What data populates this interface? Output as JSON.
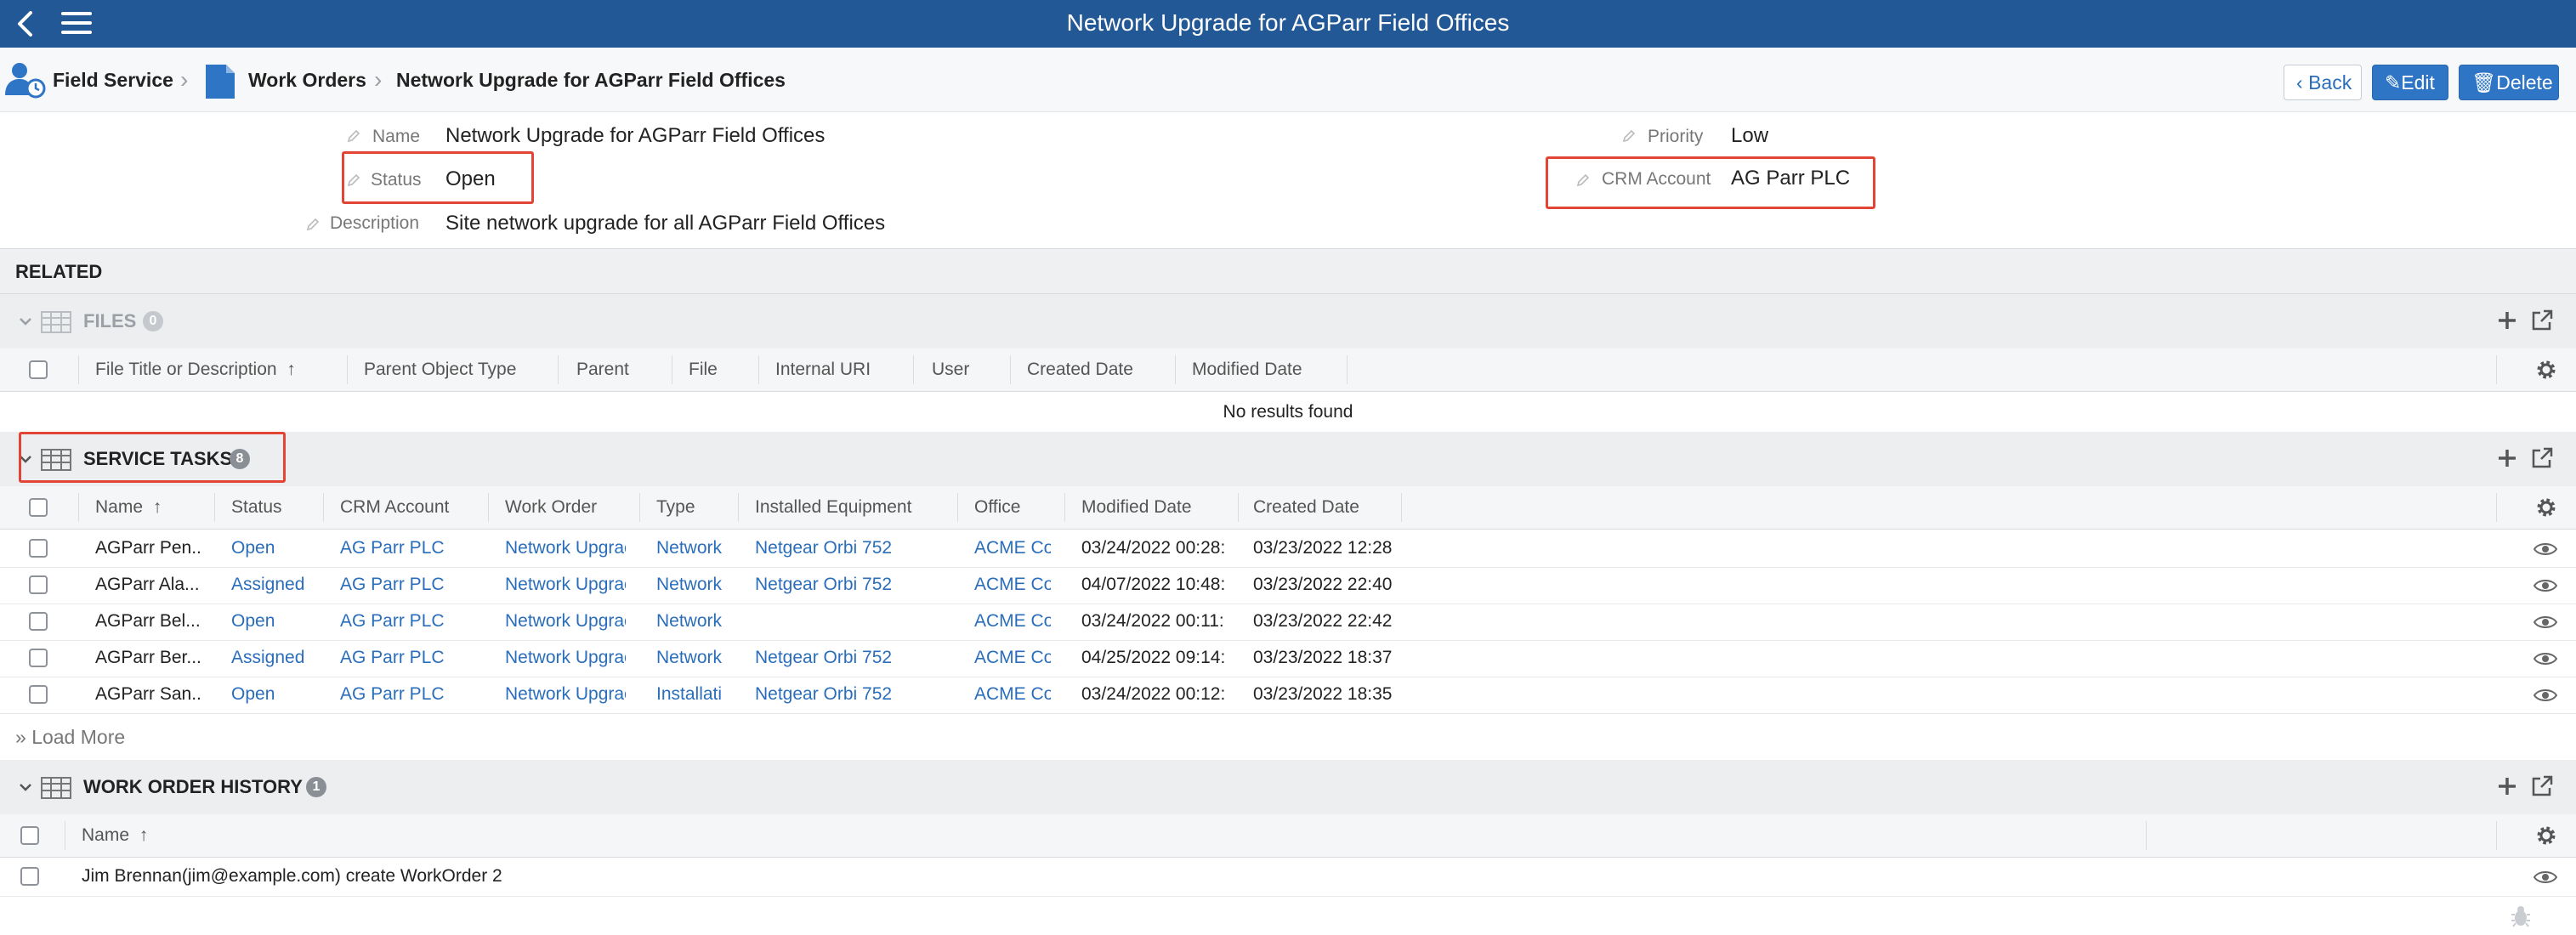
{
  "window": {
    "title": "Network Upgrade for AGParr Field Offices"
  },
  "breadcrumb": {
    "app": "Field Service",
    "section": "Work Orders",
    "record": "Network Upgrade for AGParr Field Offices"
  },
  "actions": {
    "back": "Back",
    "edit": "Edit",
    "delete": "Delete"
  },
  "fields": {
    "name": {
      "label": "Name",
      "value": "Network Upgrade for AGParr Field Offices"
    },
    "status": {
      "label": "Status",
      "value": "Open"
    },
    "description": {
      "label": "Description",
      "value": "Site network upgrade for all AGParr Field Offices"
    },
    "priority": {
      "label": "Priority",
      "value": "Low"
    },
    "crm_account": {
      "label": "CRM Account",
      "value": "AG Parr PLC"
    }
  },
  "related": {
    "heading": "RELATED",
    "files": {
      "title": "FILES",
      "count": "0",
      "columns": [
        "File Title or Description",
        "Parent Object Type",
        "Parent",
        "File",
        "Internal URI",
        "User",
        "Created Date",
        "Modified Date"
      ],
      "sort_indicator": "↑",
      "empty_text": "No results found"
    },
    "service_tasks": {
      "title": "SERVICE TASKS",
      "count": "8",
      "columns": [
        "Name",
        "Status",
        "CRM Account",
        "Work Order",
        "Type",
        "Installed Equipment",
        "Office",
        "Modified Date",
        "Created Date"
      ],
      "sort_indicator": "↑",
      "rows": [
        [
          "AGParr Pen...",
          "Open",
          "AG Parr PLC",
          "Network Upgrac",
          "Network",
          "Netgear Orbi 752",
          "ACME Cor",
          "03/24/2022 00:28:",
          "03/23/2022 12:28"
        ],
        [
          "AGParr Ala...",
          "Assigned",
          "AG Parr PLC",
          "Network Upgrac",
          "Network",
          "Netgear Orbi 752",
          "ACME Cor",
          "04/07/2022 10:48:",
          "03/23/2022 22:40"
        ],
        [
          "AGParr Bel...",
          "Open",
          "AG Parr PLC",
          "Network Upgrac",
          "Network",
          "",
          "ACME Cor",
          "03/24/2022 00:11:",
          "03/23/2022 22:42"
        ],
        [
          "AGParr Ber...",
          "Assigned",
          "AG Parr PLC",
          "Network Upgrac",
          "Network",
          "Netgear Orbi 752",
          "ACME Cor",
          "04/25/2022 09:14:",
          "03/23/2022 18:37"
        ],
        [
          "AGParr San...",
          "Open",
          "AG Parr PLC",
          "Network Upgrac",
          "Installati",
          "Netgear Orbi 752",
          "ACME Cor",
          "03/24/2022 00:12:",
          "03/23/2022 18:35"
        ]
      ],
      "load_more": "Load More"
    },
    "work_order_history": {
      "title": "WORK ORDER HISTORY",
      "count": "1",
      "columns": [
        "Name"
      ],
      "sort_indicator": "↑",
      "rows": [
        [
          "Jim Brennan(jim@example.com) create WorkOrder 2"
        ]
      ]
    }
  },
  "icons": {
    "top_left": [
      "back-chevron-icon",
      "hamburger-menu-icon"
    ],
    "app": "field-service-user-icon",
    "section": "document-icon",
    "table": "table-grid-icon",
    "add": "plus-icon",
    "open_external": "external-link-icon",
    "settings": "gear-icon",
    "row_view": "eye-icon",
    "edit_field": "pencil-icon",
    "debug": "bug-icon"
  },
  "colors": {
    "topbar": "#225895",
    "link": "#2a6ebb",
    "primary_button": "#2f75c5",
    "annotation_red": "#e24536"
  }
}
